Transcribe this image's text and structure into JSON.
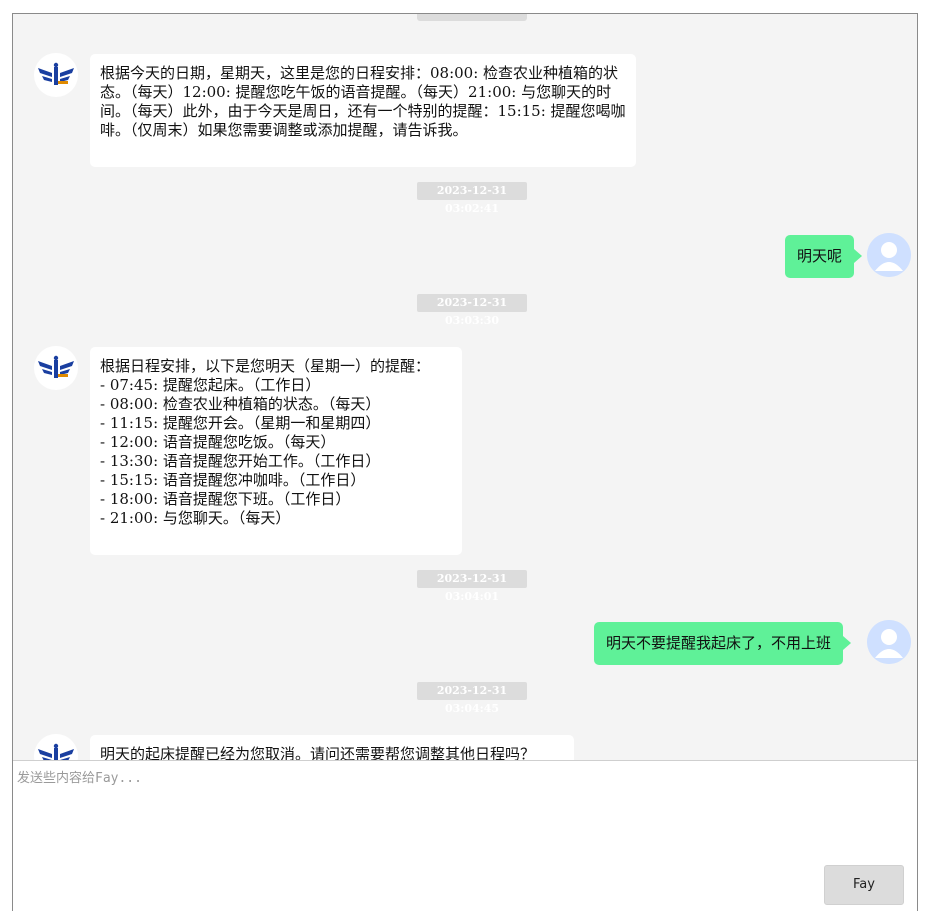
{
  "conversation": [
    {
      "role": "assistant",
      "text": "根据今天的日期，星期天，这里是您的日程安排：08:00: 检查农业种植箱的状态。（每天）12:00: 提醒您吃午饭的语音提醒。（每天）21:00: 与您聊天的时间。（每天）此外，由于今天是周日，还有一个特别的提醒：15:15: 提醒您喝咖啡。（仅周末）如果您需要调整或添加提醒，请告诉我。"
    },
    {
      "role": "timestamp",
      "text": "2023-12-31 03:02:41"
    },
    {
      "role": "user",
      "text": "明天呢"
    },
    {
      "role": "timestamp",
      "text": "2023-12-31 03:03:30"
    },
    {
      "role": "assistant",
      "text": "根据日程安排，以下是您明天（星期一）的提醒：\n- 07:45: 提醒您起床。（工作日）\n- 08:00: 检查农业种植箱的状态。（每天）\n- 11:15: 提醒您开会。（星期一和星期四）\n- 12:00: 语音提醒您吃饭。（每天）\n- 13:30: 语音提醒您开始工作。（工作日）\n- 15:15: 语音提醒您冲咖啡。（工作日）\n- 18:00: 语音提醒您下班。（工作日）\n- 21:00: 与您聊天。（每天）"
    },
    {
      "role": "timestamp",
      "text": "2023-12-31 03:04:01"
    },
    {
      "role": "user",
      "text": "明天不要提醒我起床了，不用上班"
    },
    {
      "role": "timestamp",
      "text": "2023-12-31 03:04:45"
    },
    {
      "role": "assistant",
      "text": "明天的起床提醒已经为您取消。请问还需要帮您调整其他日程吗？"
    }
  ],
  "input": {
    "placeholder": "发送些内容给Fay...",
    "value": ""
  },
  "send_button": {
    "label": "Fay"
  },
  "colors": {
    "user_bubble": "#5ff198",
    "chat_bg": "#f4f4f4",
    "timestamp_bg": "#dcdcdc",
    "bot_logo": "#1a3fa0"
  },
  "icons": {
    "assistant_avatar": "fay-logo-icon",
    "user_avatar": "user-avatar-icon"
  }
}
